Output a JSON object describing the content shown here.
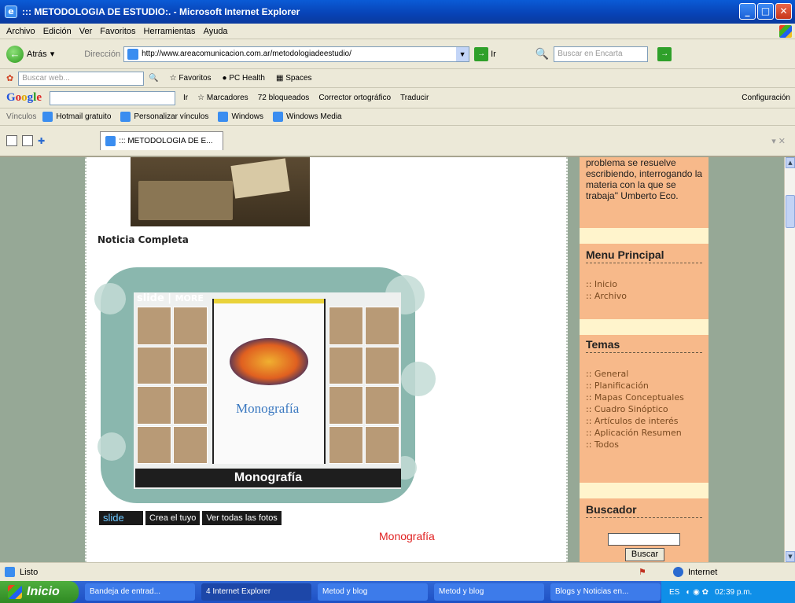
{
  "window": {
    "title": "::: METODOLOGIA DE ESTUDIO:. - Microsoft Internet Explorer"
  },
  "menu": [
    "Archivo",
    "Edición",
    "Ver",
    "Favoritos",
    "Herramientas",
    "Ayuda"
  ],
  "nav": {
    "back_label": "Atrás",
    "address_label": "Dirección",
    "url": "http://www.areacomunicacion.com.ar/metodologiadeestudio/",
    "go_label": "Ir",
    "encarta_placeholder": "Buscar en Encarta"
  },
  "searchbar": {
    "placeholder": "Buscar web...",
    "favoritos": "Favoritos",
    "pchealth": "PC Health",
    "spaces": "Spaces"
  },
  "googlebar": {
    "ir": "Ir",
    "marcadores": "Marcadores",
    "bloqueados": "72 bloqueados",
    "corrector": "Corrector ortográfico",
    "traducir": "Traducir",
    "config": "Configuración"
  },
  "links": {
    "label": "Vínculos",
    "items": [
      "Hotmail gratuito",
      "Personalizar vínculos",
      "Windows",
      "Windows Media"
    ]
  },
  "tab": {
    "title": "::: METODOLOGIA DE E..."
  },
  "content": {
    "noticia": "Noticia Completa",
    "slide_brand": "slide",
    "slide_more": "MORE",
    "slide_caption": "Monografía",
    "slide_inner_text": "Monografía",
    "btn_slide": "slide",
    "btn_crea": "Crea el tuyo",
    "btn_ver": "Ver todas las fotos",
    "link_monografia": "Monografía"
  },
  "sidebar": {
    "quote": "problema se resuelve escribiendo, interrogando la materia con la que se trabaja\" Umberto Eco.",
    "menu_title": "Menu Principal",
    "menu_items": [
      ":: Inicio",
      ":: Archivo"
    ],
    "temas_title": "Temas",
    "temas_items": [
      ":: General",
      ":: Planificación",
      ":: Mapas Conceptuales",
      ":: Cuadro Sinóptico",
      ":: Artículos de interés",
      ":: Aplicación Resumen",
      ":: Todos"
    ],
    "buscador_title": "Buscador",
    "buscar_button": "Buscar"
  },
  "status": {
    "text": "Listo",
    "zone": "Internet"
  },
  "taskbar": {
    "start": "Inicio",
    "tasks": [
      "Bandeja de entrad...",
      "4 Internet Explorer",
      "Metod y blog",
      "Metod y blog",
      "Blogs y Noticias en..."
    ],
    "lang": "ES",
    "clock": "02:39 p.m."
  },
  "colors": {
    "sidebar": "#f7b98a",
    "page_bg": "#96a896",
    "link_red": "#e02020"
  }
}
